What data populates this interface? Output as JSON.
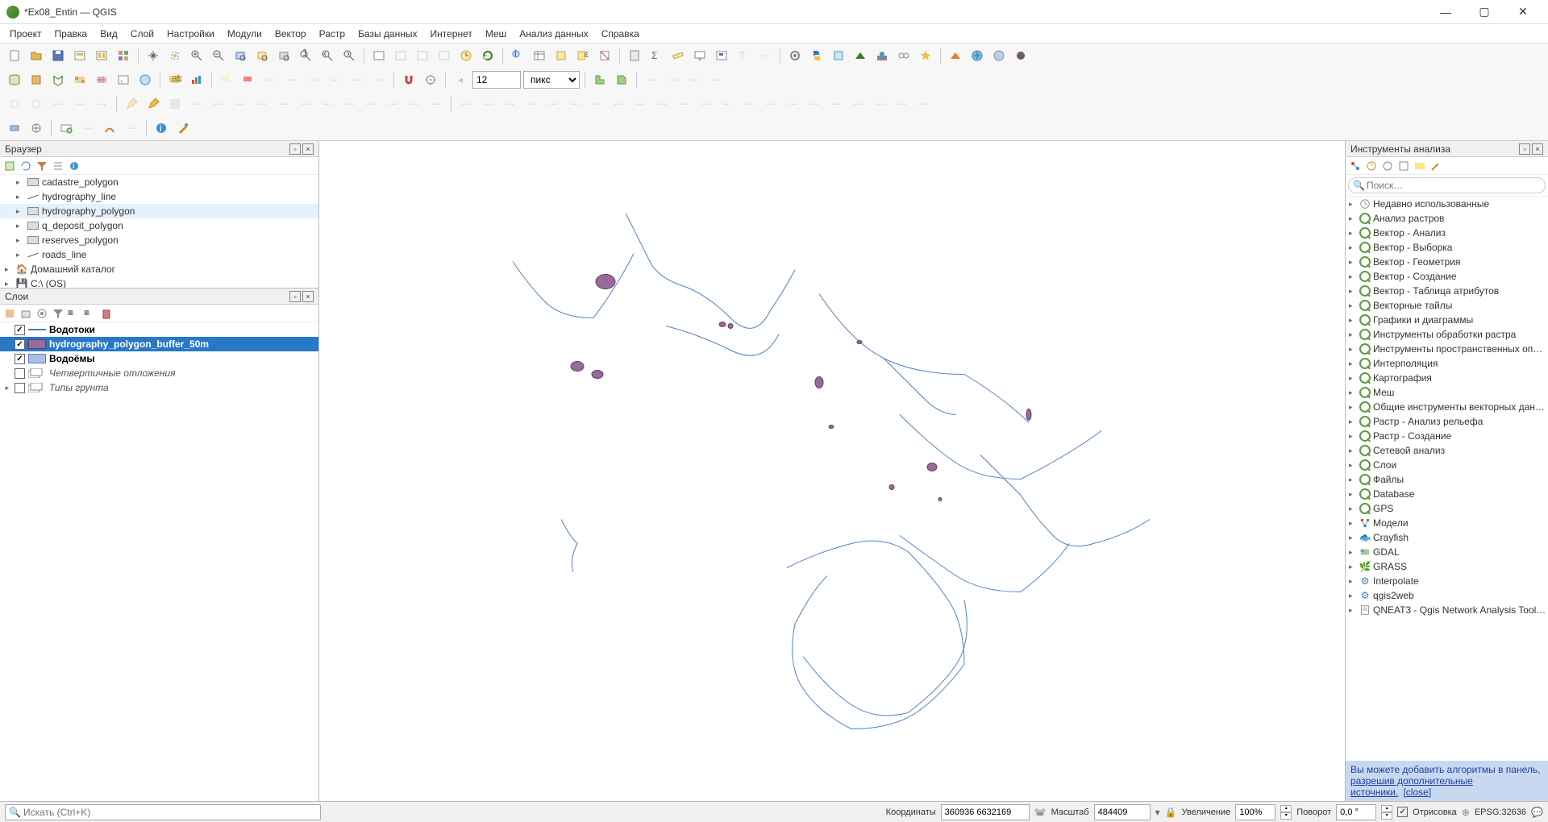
{
  "window": {
    "title": "*Ex08_Entin — QGIS"
  },
  "menu": [
    "Проект",
    "Правка",
    "Вид",
    "Слой",
    "Настройки",
    "Модули",
    "Вектор",
    "Растр",
    "Базы данных",
    "Интернет",
    "Меш",
    "Анализ данных",
    "Справка"
  ],
  "toolbar3": {
    "spin_value": "12",
    "units": "пикс"
  },
  "browser": {
    "title": "Браузер",
    "items": [
      {
        "label": "cadastre_polygon",
        "type": "poly"
      },
      {
        "label": "hydrography_line",
        "type": "line"
      },
      {
        "label": "hydrography_polygon",
        "type": "poly",
        "selected": true
      },
      {
        "label": "q_deposit_polygon",
        "type": "poly"
      },
      {
        "label": "reserves_polygon",
        "type": "poly"
      },
      {
        "label": "roads_line",
        "type": "line"
      }
    ],
    "home": "Домашний каталог",
    "drive": "C:\\ (OS)"
  },
  "layers": {
    "title": "Слои",
    "items": [
      {
        "label": "Водотоки",
        "checked": true,
        "bold": true,
        "swatch": "line-blue"
      },
      {
        "label": "hydrography_polygon_buffer_50m",
        "checked": true,
        "bold": true,
        "selected": true,
        "swatch": "fill-purple"
      },
      {
        "label": "Водоёмы",
        "checked": true,
        "bold": true,
        "swatch": "fill-blue"
      },
      {
        "label": "Четвертичные отложения",
        "checked": false,
        "italic": true,
        "swatch": "group"
      },
      {
        "label": "Типы грунта",
        "checked": false,
        "italic": true,
        "swatch": "group",
        "expandable": true
      }
    ]
  },
  "processing": {
    "title": "Инструменты анализа",
    "search_placeholder": "Поиск…",
    "items": [
      {
        "label": "Недавно использованные",
        "icon": "clock"
      },
      {
        "label": "Анализ растров",
        "icon": "q"
      },
      {
        "label": "Вектор - Анализ",
        "icon": "q"
      },
      {
        "label": "Вектор - Выборка",
        "icon": "q"
      },
      {
        "label": "Вектор - Геометрия",
        "icon": "q"
      },
      {
        "label": "Вектор - Создание",
        "icon": "q"
      },
      {
        "label": "Вектор - Таблица атрибутов",
        "icon": "q"
      },
      {
        "label": "Векторные тайлы",
        "icon": "q"
      },
      {
        "label": "Графики и диаграммы",
        "icon": "q"
      },
      {
        "label": "Инструменты обработки растра",
        "icon": "q"
      },
      {
        "label": "Инструменты пространственных оп…",
        "icon": "q"
      },
      {
        "label": "Интерполяция",
        "icon": "q"
      },
      {
        "label": "Картография",
        "icon": "q"
      },
      {
        "label": "Меш",
        "icon": "q"
      },
      {
        "label": "Общие инструменты векторных дан…",
        "icon": "q"
      },
      {
        "label": "Растр - Анализ рельефа",
        "icon": "q"
      },
      {
        "label": "Растр - Создание",
        "icon": "q"
      },
      {
        "label": "Сетевой анализ",
        "icon": "q"
      },
      {
        "label": "Слои",
        "icon": "q"
      },
      {
        "label": "Файлы",
        "icon": "q"
      },
      {
        "label": "Database",
        "icon": "q"
      },
      {
        "label": "GPS",
        "icon": "q"
      },
      {
        "label": "Модели",
        "icon": "model"
      },
      {
        "label": "Crayfish",
        "icon": "cray"
      },
      {
        "label": "GDAL",
        "icon": "gdal"
      },
      {
        "label": "GRASS",
        "icon": "grass"
      },
      {
        "label": "Interpolate",
        "icon": "gear"
      },
      {
        "label": "qgis2web",
        "icon": "gear"
      },
      {
        "label": "QNEAT3 - Qgis Network Analysis Tool…",
        "icon": "script"
      }
    ],
    "hint_text": "Вы можете добавить алгоритмы в панель, ",
    "hint_link1": "разрешив дополнительные источники.",
    "hint_link2": "[close]"
  },
  "status": {
    "locator_placeholder": "Искать (Ctrl+K)",
    "coord_label": "Координаты",
    "coord_value": "360936 6632169",
    "scale_label": "Масштаб",
    "scale_value": "484409",
    "mag_label": "Увеличение",
    "mag_value": "100%",
    "rot_label": "Поворот",
    "rot_value": "0,0 °",
    "render_label": "Отрисовка",
    "crs": "EPSG:32636"
  }
}
